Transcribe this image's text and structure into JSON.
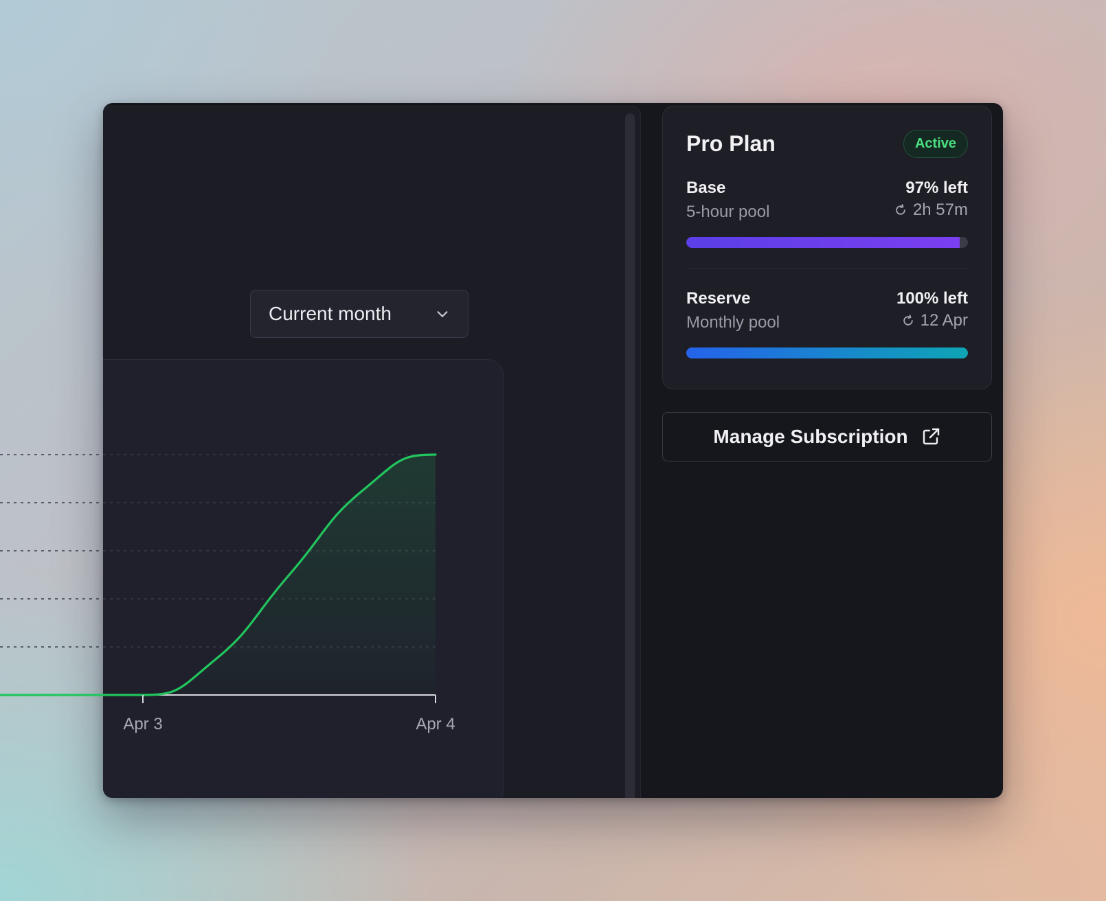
{
  "range_select": {
    "selected": "Current month",
    "icon": "chevron-down-icon"
  },
  "chart_data": {
    "type": "area",
    "x_ticks": [
      "Apr 3",
      "Apr 4"
    ],
    "series": [
      {
        "x": [
          "Apr 3",
          "Apr 3.25",
          "Apr 3.5",
          "Apr 3.75",
          "Apr 4"
        ],
        "values": [
          0,
          0.15,
          0.5,
          0.85,
          1.0
        ]
      }
    ],
    "grid": true,
    "line_color": "#22c55e"
  },
  "plan": {
    "title": "Pro Plan",
    "status": "Active",
    "status_color": "#4ade80",
    "pools": [
      {
        "name": "Base",
        "subtitle": "5-hour pool",
        "percent_label": "97% left",
        "remaining": 0.97,
        "reset_icon": "refresh-icon",
        "reset_label": "2h 57m"
      },
      {
        "name": "Reserve",
        "subtitle": "Monthly pool",
        "percent_label": "100% left",
        "remaining": 1.0,
        "reset_icon": "refresh-icon",
        "reset_label": "12 Apr"
      }
    ]
  },
  "manage_button": {
    "label": "Manage Subscription",
    "icon": "external-link-icon"
  }
}
